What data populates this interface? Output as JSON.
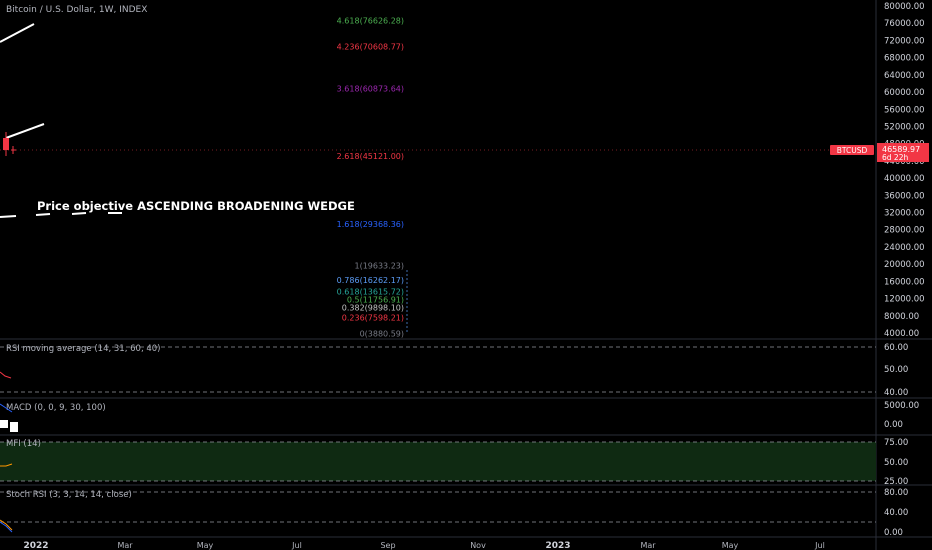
{
  "header": {
    "symbol_title": "Bitcoin / U.S. Dollar, 1W, INDEX"
  },
  "annotation": {
    "text": "Price objective ASCENDING BROADENING WEDGE"
  },
  "price_axis": {
    "labels": [
      "80000.00",
      "76000.00",
      "72000.00",
      "68000.00",
      "64000.00",
      "60000.00",
      "56000.00",
      "52000.00",
      "48000.00",
      "44000.00",
      "40000.00",
      "36000.00",
      "32000.00",
      "28000.00",
      "24000.00",
      "20000.00",
      "16000.00",
      "12000.00",
      "8000.00",
      "4000.00"
    ]
  },
  "current_price": {
    "symbol": "BTCUSD",
    "price": "46589.97",
    "countdown": "6d 22h",
    "color": "#f23645"
  },
  "time_axis": {
    "labels": [
      "2022",
      "Mar",
      "May",
      "Jul",
      "Sep",
      "Nov",
      "2023",
      "Mar",
      "May",
      "Jul"
    ]
  },
  "fib_levels": [
    {
      "label": "4.618(76626.28)",
      "color": "#4caf50"
    },
    {
      "label": "4.236(70608.77)",
      "color": "#f23645"
    },
    {
      "label": "3.618(60873.64)",
      "color": "#9c27b0"
    },
    {
      "label": "2.618(45121.00)",
      "color": "#f23645"
    },
    {
      "label": "1.618(29368.36)",
      "color": "#2962ff"
    },
    {
      "label": "1(19633.23)",
      "color": "#787b86"
    },
    {
      "label": "0.786(16262.17)",
      "color": "#5b9cf6"
    },
    {
      "label": "0.618(13615.72)",
      "color": "#26a69a"
    },
    {
      "label": "0.5(11756.91)",
      "color": "#4caf50"
    },
    {
      "label": "0.382(9898.10)",
      "color": "#c0c0c0"
    },
    {
      "label": "0.236(7598.21)",
      "color": "#f23645"
    },
    {
      "label": "0(3880.59)",
      "color": "#787b86"
    }
  ],
  "panels": [
    {
      "title": "RSI moving average (14, 31, 60, 40)",
      "axis": [
        "60.00",
        "50.00",
        "40.00"
      ]
    },
    {
      "title": "MACD (0, 0, 9, 30, 100)",
      "axis": [
        "5000.00",
        "0.00"
      ]
    },
    {
      "title": "MFI (14)",
      "axis": [
        "75.00",
        "50.00",
        "25.00"
      ]
    },
    {
      "title": "Stoch RSI (3, 3, 14, 14, close)",
      "axis": [
        "80.00",
        "40.00",
        "0.00"
      ]
    }
  ],
  "chart_data": {
    "type": "line",
    "title": "Bitcoin / U.S. Dollar, 1W, INDEX",
    "ylim": [
      0,
      82000
    ],
    "y_axis_side": "right",
    "grid": false,
    "current_price": 46589.97,
    "fibonacci_extension": [
      {
        "ratio": 4.618,
        "price": 76626.28
      },
      {
        "ratio": 4.236,
        "price": 70608.77
      },
      {
        "ratio": 3.618,
        "price": 60873.64
      },
      {
        "ratio": 2.618,
        "price": 45121.0
      },
      {
        "ratio": 1.618,
        "price": 29368.36
      },
      {
        "ratio": 1,
        "price": 19633.23
      },
      {
        "ratio": 0.786,
        "price": 16262.17
      },
      {
        "ratio": 0.618,
        "price": 13615.72
      },
      {
        "ratio": 0.5,
        "price": 11756.91
      },
      {
        "ratio": 0.382,
        "price": 9898.1
      },
      {
        "ratio": 0.236,
        "price": 7598.21
      },
      {
        "ratio": 0,
        "price": 3880.59
      }
    ],
    "annotations": [
      "Price objective ASCENDING BROADENING WEDGE"
    ]
  }
}
